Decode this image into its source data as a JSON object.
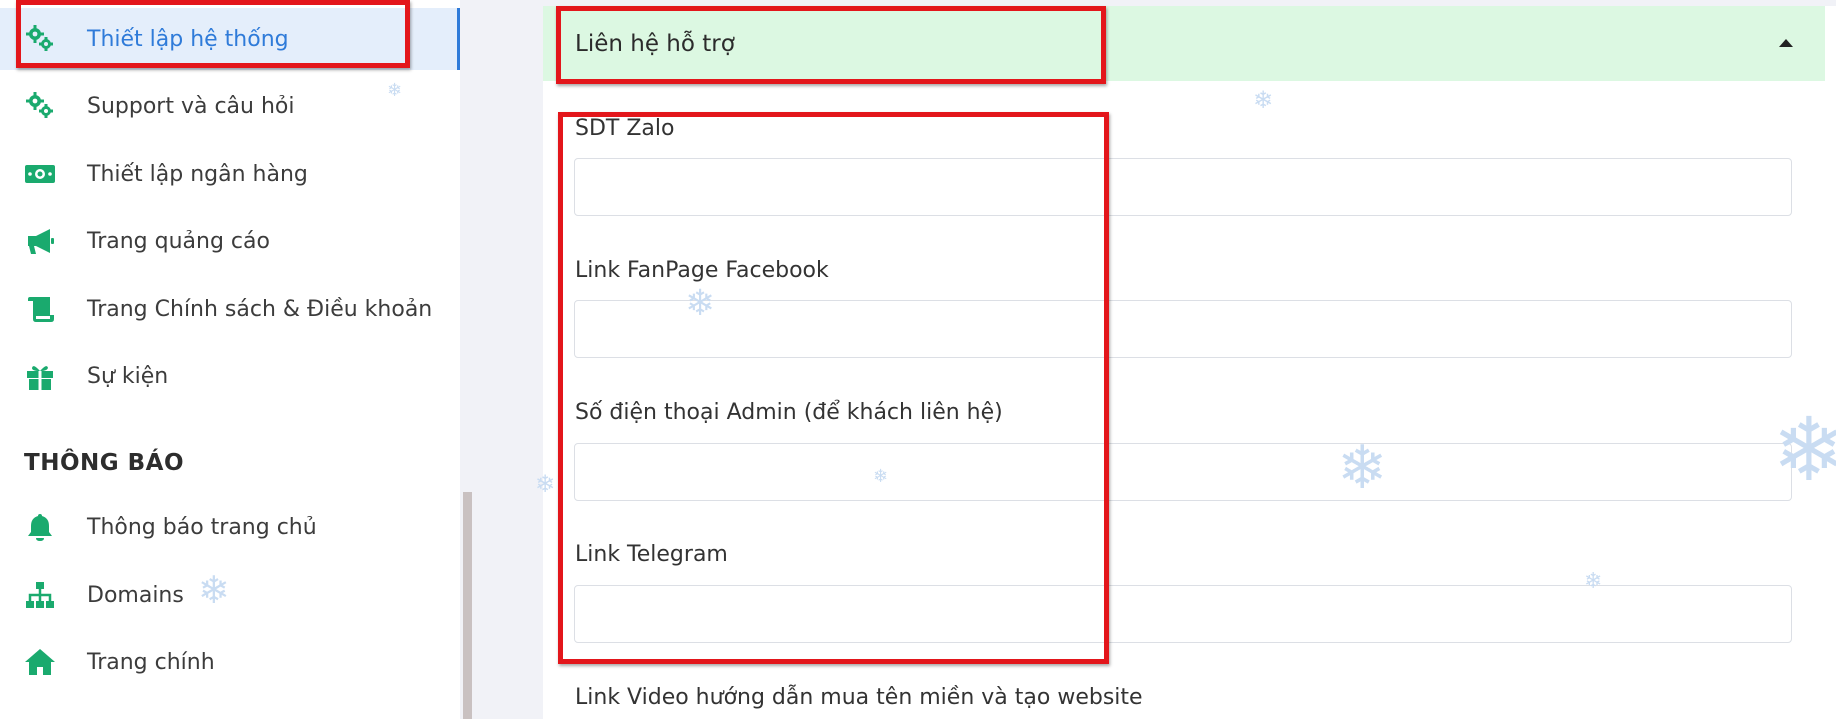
{
  "sidebar": {
    "items": [
      {
        "label": "Thiết lập hệ thống",
        "icon": "cogs-icon"
      },
      {
        "label": "Support và câu hỏi",
        "icon": "cogs-icon"
      },
      {
        "label": "Thiết lập ngân hàng",
        "icon": "money-bill-icon"
      },
      {
        "label": "Trang quảng cáo",
        "icon": "megaphone-icon"
      },
      {
        "label": "Trang Chính sách & Điều khoản",
        "icon": "scroll-icon"
      },
      {
        "label": "Sự kiện",
        "icon": "gift-icon"
      }
    ],
    "section_title": "THÔNG BÁO",
    "section_items": [
      {
        "label": "Thông báo trang chủ",
        "icon": "bell-icon"
      },
      {
        "label": "Domains",
        "icon": "sitemap-icon"
      },
      {
        "label": "Trang chính",
        "icon": "home-icon"
      }
    ],
    "active_index": 0
  },
  "panel": {
    "title": "Liên hệ hỗ trợ",
    "fields": [
      {
        "label": "SDT Zalo",
        "value": ""
      },
      {
        "label": "Link FanPage Facebook",
        "value": ""
      },
      {
        "label": "Số điện thoại Admin (để khách liên hệ)",
        "value": ""
      },
      {
        "label": "Link Telegram",
        "value": ""
      }
    ],
    "next_field_label": "Link Video hướng dẫn mua tên miền và tạo website"
  },
  "colors": {
    "accent": "#2f7bd9",
    "icon_green": "#1aaa6e",
    "header_bg": "#dcf8e2",
    "highlight_outline": "#e3161b"
  }
}
